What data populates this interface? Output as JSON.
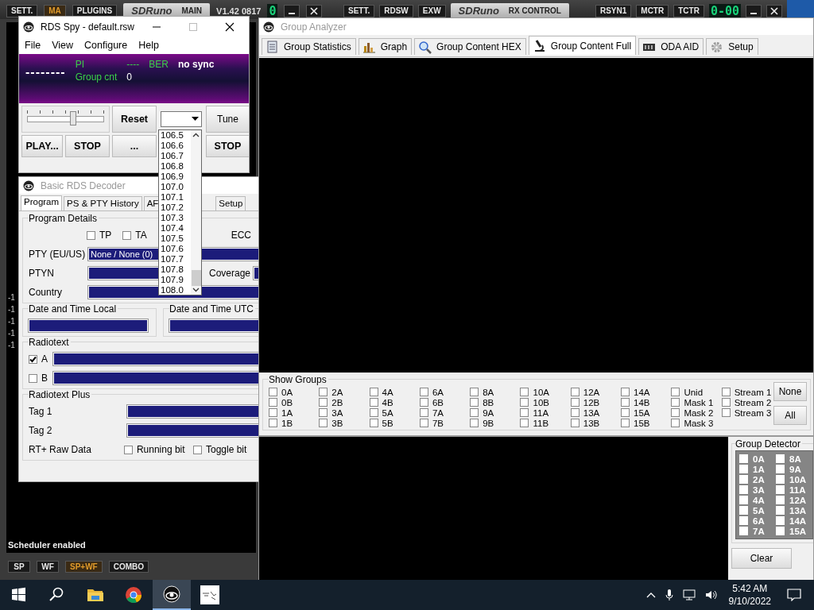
{
  "main_bar": {
    "buttons": [
      {
        "label": "SETT.",
        "selected": false
      },
      {
        "label": "MA",
        "selected": true
      },
      {
        "label": "PLUGINS",
        "selected": false
      }
    ],
    "logo": "SDRuno",
    "panel": "MAIN",
    "version": "V1.42 0817",
    "display": "0"
  },
  "rx_bar": {
    "buttons_left": [
      "SETT.",
      "RDSW",
      "EXW"
    ],
    "logo": "SDRuno",
    "panel": "RX CONTROL",
    "buttons_right": [
      "RSYN1",
      "MCTR",
      "TCTR"
    ],
    "display": "0-00"
  },
  "main_window": {
    "axis_labels": [
      "-1",
      "-1",
      "-1",
      "-1",
      "-1"
    ],
    "status": "Scheduler enabled",
    "view_buttons": [
      {
        "label": "SP",
        "selected": false
      },
      {
        "label": "WF",
        "selected": false
      },
      {
        "label": "SP+WF",
        "selected": true
      },
      {
        "label": "COMBO",
        "selected": false
      }
    ]
  },
  "rds_spy": {
    "title": "RDS Spy - default.rsw",
    "menu": [
      "File",
      "View",
      "Configure",
      "Help"
    ],
    "display": {
      "ps": "--------",
      "pi_label": "PI",
      "pi": "----",
      "ber_label": "BER",
      "sync": "no sync",
      "group_cnt_label": "Group cnt",
      "group_cnt": "0"
    },
    "slider": {
      "level": 0.6
    },
    "buttons": [
      "Reset",
      "Tune",
      "PLAY...",
      "STOP",
      "...",
      "STOP"
    ],
    "frequency_list": [
      "106.5",
      "106.6",
      "106.7",
      "106.8",
      "106.9",
      "107.0",
      "107.1",
      "107.2",
      "107.3",
      "107.4",
      "107.5",
      "107.6",
      "107.7",
      "107.8",
      "107.9",
      "108.0"
    ]
  },
  "basic_rds_decoder": {
    "title": "Basic RDS Decoder",
    "tabs": [
      {
        "label": "Program",
        "selected": true
      },
      {
        "label": "PS & PTY History",
        "selected": false
      },
      {
        "label": "AF",
        "selected": false
      },
      {
        "label": "Setup",
        "selected": false
      }
    ],
    "program_details": {
      "title": "Program Details",
      "tp": {
        "label": "TP",
        "checked": false
      },
      "ta": {
        "label": "TA",
        "checked": false
      },
      "ecc_label": "ECC",
      "pty_label": "PTY (EU/US)",
      "pty": "None / None (0)",
      "ptyn_label": "PTYN",
      "coverage_label": "Coverage",
      "country_label": "Country"
    },
    "date_local": "Date and Time Local",
    "date_utc": "Date and Time UTC",
    "radiotext": {
      "title": "Radiotext",
      "rows": [
        {
          "label": "A",
          "checked": true
        },
        {
          "label": "B",
          "checked": false
        }
      ]
    },
    "radiotext_plus": {
      "title": "Radiotext Plus",
      "tag1_label": "Tag 1",
      "tag2_label": "Tag 2",
      "raw_label": "RT+ Raw Data",
      "bits": [
        {
          "label": "Running bit",
          "checked": false
        },
        {
          "label": "Toggle bit",
          "checked": false
        }
      ]
    }
  },
  "group_analyzer": {
    "title": "Group Analyzer",
    "tabs": [
      {
        "label": "Group Statistics",
        "selected": false
      },
      {
        "label": "Graph",
        "selected": false
      },
      {
        "label": "Group Content HEX",
        "selected": false
      },
      {
        "label": "Group Content Full",
        "selected": true
      },
      {
        "label": "ODA AID",
        "selected": false
      },
      {
        "label": "Setup",
        "selected": false
      }
    ],
    "show_groups": {
      "title": "Show Groups",
      "items": [
        {
          "label": "0A",
          "checked": false
        },
        {
          "label": "0B",
          "checked": false
        },
        {
          "label": "1A",
          "checked": false
        },
        {
          "label": "1B",
          "checked": false
        },
        {
          "label": "2A",
          "checked": false
        },
        {
          "label": "2B",
          "checked": false
        },
        {
          "label": "3A",
          "checked": false
        },
        {
          "label": "3B",
          "checked": false
        },
        {
          "label": "4A",
          "checked": false
        },
        {
          "label": "4B",
          "checked": false
        },
        {
          "label": "5A",
          "checked": false
        },
        {
          "label": "5B",
          "checked": false
        },
        {
          "label": "6A",
          "checked": false
        },
        {
          "label": "6B",
          "checked": false
        },
        {
          "label": "7A",
          "checked": false
        },
        {
          "label": "7B",
          "checked": false
        },
        {
          "label": "8A",
          "checked": false
        },
        {
          "label": "8B",
          "checked": false
        },
        {
          "label": "9A",
          "checked": false
        },
        {
          "label": "9B",
          "checked": false
        },
        {
          "label": "10A",
          "checked": false
        },
        {
          "label": "10B",
          "checked": false
        },
        {
          "label": "11A",
          "checked": false
        },
        {
          "label": "11B",
          "checked": false
        },
        {
          "label": "12A",
          "checked": false
        },
        {
          "label": "12B",
          "checked": false
        },
        {
          "label": "13A",
          "checked": false
        },
        {
          "label": "13B",
          "checked": false
        },
        {
          "label": "14A",
          "checked": false
        },
        {
          "label": "14B",
          "checked": false
        },
        {
          "label": "15A",
          "checked": false
        },
        {
          "label": "15B",
          "checked": false
        },
        {
          "label": "Unid",
          "checked": false
        },
        {
          "label": "Mask 1",
          "checked": false
        },
        {
          "label": "Mask 2",
          "checked": false
        },
        {
          "label": "Mask 3",
          "checked": false
        },
        {
          "label": "Stream 1",
          "checked": false
        },
        {
          "label": "Stream 2",
          "checked": false
        },
        {
          "label": "Stream 3",
          "checked": false
        }
      ],
      "buttons": [
        "None",
        "All"
      ]
    },
    "group_detector": {
      "title": "Group Detector",
      "items": [
        {
          "label": "0A",
          "checked": false
        },
        {
          "label": "1A",
          "checked": false
        },
        {
          "label": "2A",
          "checked": false
        },
        {
          "label": "3A",
          "checked": false
        },
        {
          "label": "4A",
          "checked": false
        },
        {
          "label": "5A",
          "checked": false
        },
        {
          "label": "6A",
          "checked": false
        },
        {
          "label": "7A",
          "checked": false
        },
        {
          "label": "8A",
          "checked": false
        },
        {
          "label": "9A",
          "checked": false
        },
        {
          "label": "10A",
          "checked": false
        },
        {
          "label": "11A",
          "checked": false
        },
        {
          "label": "12A",
          "checked": false
        },
        {
          "label": "13A",
          "checked": false
        },
        {
          "label": "14A",
          "checked": false
        },
        {
          "label": "15A",
          "checked": false
        }
      ],
      "button": "Clear"
    }
  },
  "taskbar": {
    "apps": [
      {
        "selected": false
      },
      {
        "selected": false
      },
      {
        "selected": false
      },
      {
        "selected": false
      },
      {
        "selected": true
      },
      {
        "selected": false
      }
    ],
    "time": "5:42 AM",
    "date": "9/10/2022"
  }
}
